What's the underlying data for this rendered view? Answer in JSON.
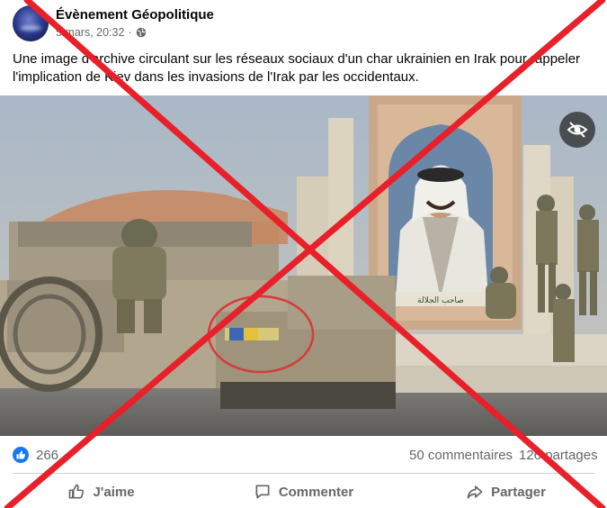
{
  "post": {
    "page_name": "Évènement Géopolitique",
    "timestamp": "5 mars, 20:32",
    "separator": "·",
    "text": "Une image d'archive circulant sur les réseaux sociaux d'un char ukrainien en Irak pour rappeler l'implication de Kiev dans les invasions de l'Irak par les occidentaux.",
    "portrait_caption": "صاحب الجلالة"
  },
  "reactions": {
    "count": "266",
    "comments": "50 commentaires",
    "shares": "126 partages"
  },
  "actions": {
    "like": "J'aime",
    "comment": "Commenter",
    "share": "Partager"
  },
  "icons": [
    "globe-icon",
    "eye-slash-icon",
    "like-reaction-icon",
    "thumbs-up-icon",
    "comment-icon",
    "share-icon"
  ],
  "colors": {
    "accent": "#1877f2",
    "secondary_text": "#65676b",
    "cross": "#e8202a"
  }
}
